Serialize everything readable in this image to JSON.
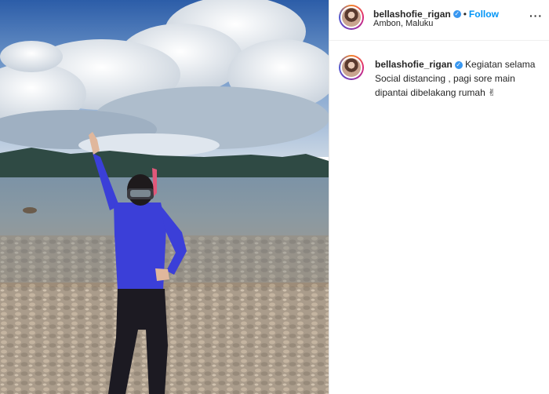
{
  "post": {
    "username": "bellashofie_rigan",
    "location": "Ambon, Maluku",
    "follow_label": "Follow",
    "separator": "•",
    "verified_mark": "✓",
    "more_icon": "···",
    "caption_lines": [
      "Kegiatan selama",
      "Social distancing , pagi sore main",
      "dipantai dibelakang rumah"
    ],
    "caption_emoji": "✌"
  },
  "colors": {
    "accent": "#0095f6",
    "verified": "#3897f0",
    "shirt": "#3b3fd8",
    "sky": "#3a6fb5"
  },
  "icons": [
    "verified-badge-icon",
    "more-options-icon",
    "victory-hand-icon"
  ]
}
